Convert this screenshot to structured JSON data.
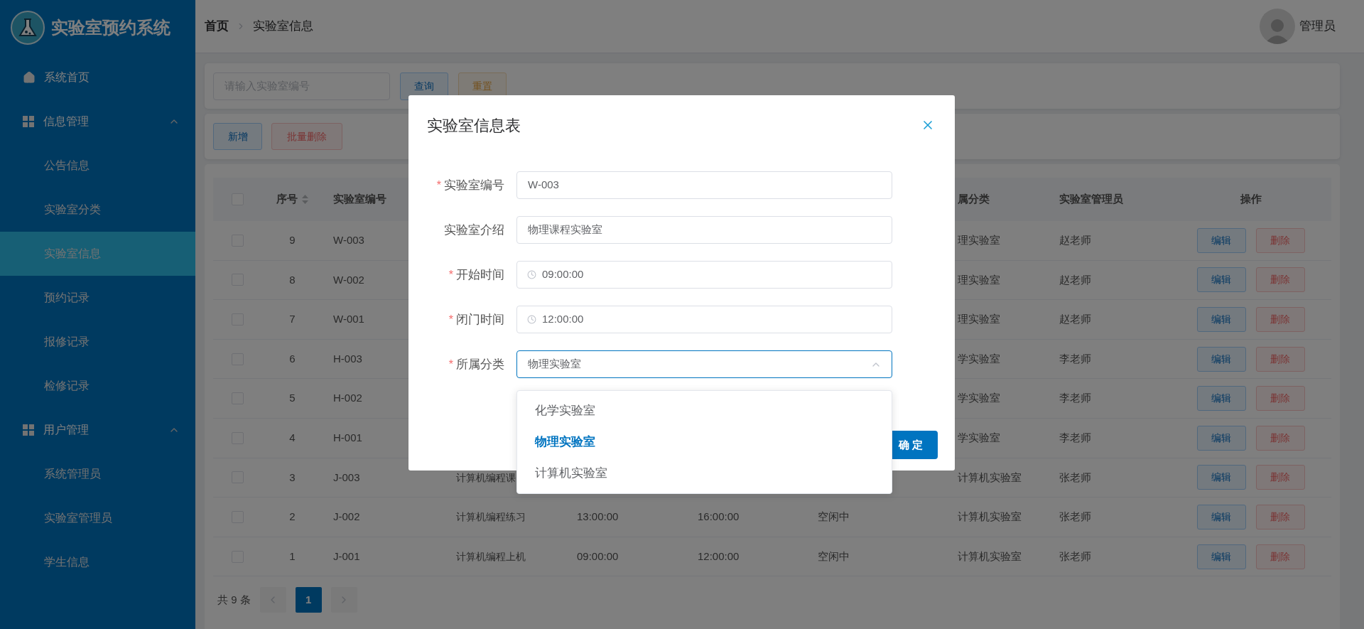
{
  "sidebar": {
    "title": "实验室预约系统",
    "items": [
      {
        "kind": "link",
        "label": "系统首页",
        "selected": false
      },
      {
        "kind": "group",
        "label": "信息管理",
        "expanded": true,
        "children": [
          {
            "label": "公告信息",
            "selected": false
          },
          {
            "label": "实验室分类",
            "selected": false
          },
          {
            "label": "实验室信息",
            "selected": true
          },
          {
            "label": "预约记录",
            "selected": false
          },
          {
            "label": "报修记录",
            "selected": false
          },
          {
            "label": "检修记录",
            "selected": false
          }
        ]
      },
      {
        "kind": "group",
        "label": "用户管理",
        "expanded": true,
        "children": [
          {
            "label": "系统管理员",
            "selected": false
          },
          {
            "label": "实验室管理员",
            "selected": false
          },
          {
            "label": "学生信息",
            "selected": false
          }
        ]
      }
    ]
  },
  "header": {
    "breadcrumb": [
      "首页",
      "实验室信息"
    ],
    "user": "管理员"
  },
  "search": {
    "placeholder": "请输入实验室编号",
    "buttons": [
      {
        "label": "查询",
        "kind": "info"
      },
      {
        "label": "重置",
        "kind": "warning"
      }
    ]
  },
  "toolbar": {
    "buttons": [
      {
        "label": "新增",
        "kind": "info"
      },
      {
        "label": "批量删除",
        "kind": "danger"
      }
    ]
  },
  "table": {
    "header": {
      "checked": false,
      "no": "序号",
      "code": "实验室编号",
      "category": "属分类",
      "admin": "实验室管理员",
      "actions": "操作"
    },
    "rows": [
      {
        "checked": false,
        "no": "9",
        "code": "W-003",
        "category": "理实验室",
        "admin": "赵老师",
        "actions": [
          {
            "label": "编辑",
            "kind": "info"
          },
          {
            "label": "删除",
            "kind": "danger"
          }
        ]
      },
      {
        "checked": false,
        "no": "8",
        "code": "W-002",
        "category": "理实验室",
        "admin": "赵老师",
        "actions": [
          {
            "label": "编辑",
            "kind": "info"
          },
          {
            "label": "删除",
            "kind": "danger"
          }
        ]
      },
      {
        "checked": false,
        "no": "7",
        "code": "W-001",
        "category": "理实验室",
        "admin": "赵老师",
        "actions": [
          {
            "label": "编辑",
            "kind": "info"
          },
          {
            "label": "删除",
            "kind": "danger"
          }
        ]
      },
      {
        "checked": false,
        "no": "6",
        "code": "H-003",
        "category": "学实验室",
        "admin": "李老师",
        "actions": [
          {
            "label": "编辑",
            "kind": "info"
          },
          {
            "label": "删除",
            "kind": "danger"
          }
        ]
      },
      {
        "checked": false,
        "no": "5",
        "code": "H-002",
        "category": "学实验室",
        "admin": "李老师",
        "actions": [
          {
            "label": "编辑",
            "kind": "info"
          },
          {
            "label": "删除",
            "kind": "danger"
          }
        ]
      },
      {
        "checked": false,
        "no": "4",
        "code": "H-001",
        "category": "学实验室",
        "admin": "李老师",
        "actions": [
          {
            "label": "编辑",
            "kind": "info"
          },
          {
            "label": "删除",
            "kind": "danger"
          }
        ]
      },
      {
        "checked": false,
        "no": "3",
        "code": "J-003",
        "intro": "计算机编程课",
        "category": "计算机实验室",
        "admin": "张老师",
        "actions": [
          {
            "label": "编辑",
            "kind": "info"
          },
          {
            "label": "删除",
            "kind": "danger"
          }
        ]
      },
      {
        "checked": false,
        "no": "2",
        "code": "J-002",
        "intro": "计算机编程练习",
        "start": "13:00:00",
        "end": "16:00:00",
        "status": "空闲中",
        "category": "计算机实验室",
        "admin": "张老师",
        "actions": [
          {
            "label": "编辑",
            "kind": "info"
          },
          {
            "label": "删除",
            "kind": "danger"
          }
        ]
      },
      {
        "checked": false,
        "no": "1",
        "code": "J-001",
        "intro": "计算机编程上机",
        "start": "09:00:00",
        "end": "12:00:00",
        "status": "空闲中",
        "category": "计算机实验室",
        "admin": "张老师",
        "actions": [
          {
            "label": "编辑",
            "kind": "info"
          },
          {
            "label": "删除",
            "kind": "danger"
          }
        ]
      }
    ]
  },
  "pagination": {
    "total": "共 9 条",
    "pages": [
      {
        "label": "1",
        "selected": true
      }
    ]
  },
  "dialog": {
    "title": "实验室信息表",
    "fields": [
      {
        "kind": "text",
        "required_mark": "*",
        "label": "实验室编号",
        "value": "W-003"
      },
      {
        "kind": "text",
        "label": "实验室介绍",
        "value": "物理课程实验室"
      },
      {
        "kind": "time",
        "required_mark": "*",
        "label": "开始时间",
        "value": "09:00:00"
      },
      {
        "kind": "time",
        "required_mark": "*",
        "label": "闭门时间",
        "value": "12:00:00"
      },
      {
        "kind": "select",
        "required_mark": "*",
        "label": "所属分类",
        "value": "物理实验室",
        "expanded": true,
        "options": [
          {
            "label": "化学实验室",
            "selected": false
          },
          {
            "label": "物理实验室",
            "selected": true
          },
          {
            "label": "计算机实验室",
            "selected": false
          }
        ]
      }
    ],
    "confirm": "确 定"
  }
}
